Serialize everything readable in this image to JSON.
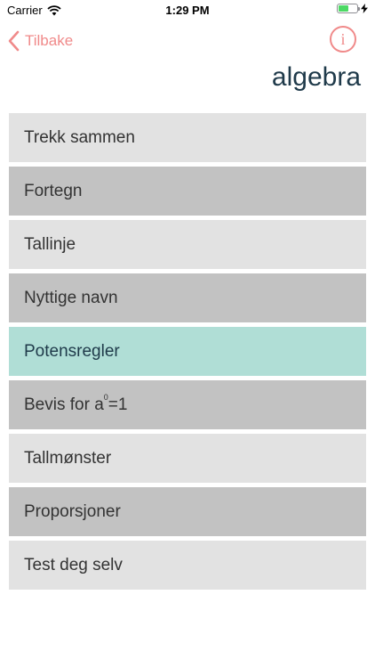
{
  "status_bar": {
    "carrier": "Carrier",
    "time": "1:29 PM",
    "battery_level": 0.55,
    "battery_color": "#4cd964"
  },
  "nav": {
    "back_label": "Tilbake",
    "back_icon": "chevron-left-icon",
    "info_icon": "info-icon",
    "info_glyph": "i",
    "accent_color": "#f08a8a"
  },
  "page": {
    "title": "algebra"
  },
  "menu": {
    "items": [
      {
        "label": "Trekk sammen"
      },
      {
        "label": "Fortegn"
      },
      {
        "label": "Tallinje"
      },
      {
        "label": "Nyttige navn"
      },
      {
        "label": "Potensregler",
        "selected": true
      },
      {
        "label_prefix": "Bevis for a",
        "label_sup": "0",
        "label_suffix": "=1"
      },
      {
        "label": "Tallmønster"
      },
      {
        "label": "Proporsjoner"
      },
      {
        "label": "Test deg selv"
      }
    ],
    "colors": {
      "light": "#e2e2e2",
      "dark": "#c2c2c2",
      "selected": "#b0ded6"
    }
  }
}
